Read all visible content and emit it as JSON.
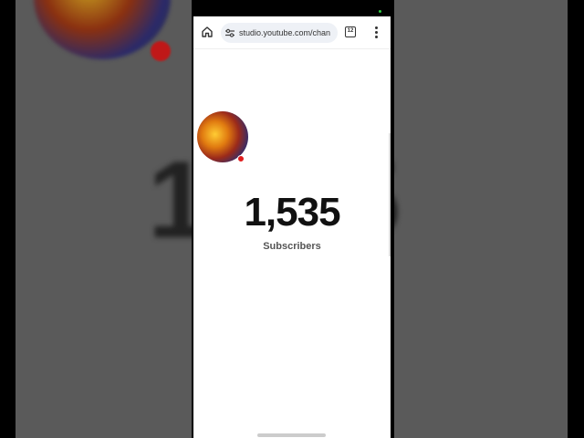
{
  "browser": {
    "url": "studio.youtube.com/chan",
    "tab_count": "12"
  },
  "channel": {
    "subscriber_count": "1,535",
    "subscriber_label": "Subscribers"
  },
  "background": {
    "blurred_count_left": "1",
    "blurred_count_right": "5"
  },
  "colors": {
    "page_bg": "#ffffff",
    "text": "#111111",
    "live_dot": "#e01c1c"
  }
}
